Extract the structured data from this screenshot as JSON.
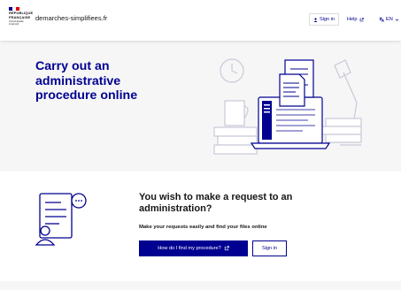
{
  "header": {
    "logo": {
      "line1": "RÉPUBLIQUE",
      "line2": "FRANÇAISE",
      "motto": "Liberté Égalité Fraternité",
      "flag_colors": [
        "#000091",
        "#ffffff",
        "#e1000f"
      ]
    },
    "site_name": "demarches-simplifiees.fr",
    "signin_label": "Sign in",
    "help_label": "Help",
    "lang_label": "EN"
  },
  "hero": {
    "title": "Carry out an administrative procedure online"
  },
  "cta": {
    "title": "You wish to make a request to an administration?",
    "subtitle": "Make your requests easily and find your files online",
    "primary_button": "How do I find my procedure?",
    "secondary_button": "Sign in"
  },
  "colors": {
    "brand_blue": "#000091",
    "hero_bg": "#f6f6f6",
    "text": "#161616"
  }
}
